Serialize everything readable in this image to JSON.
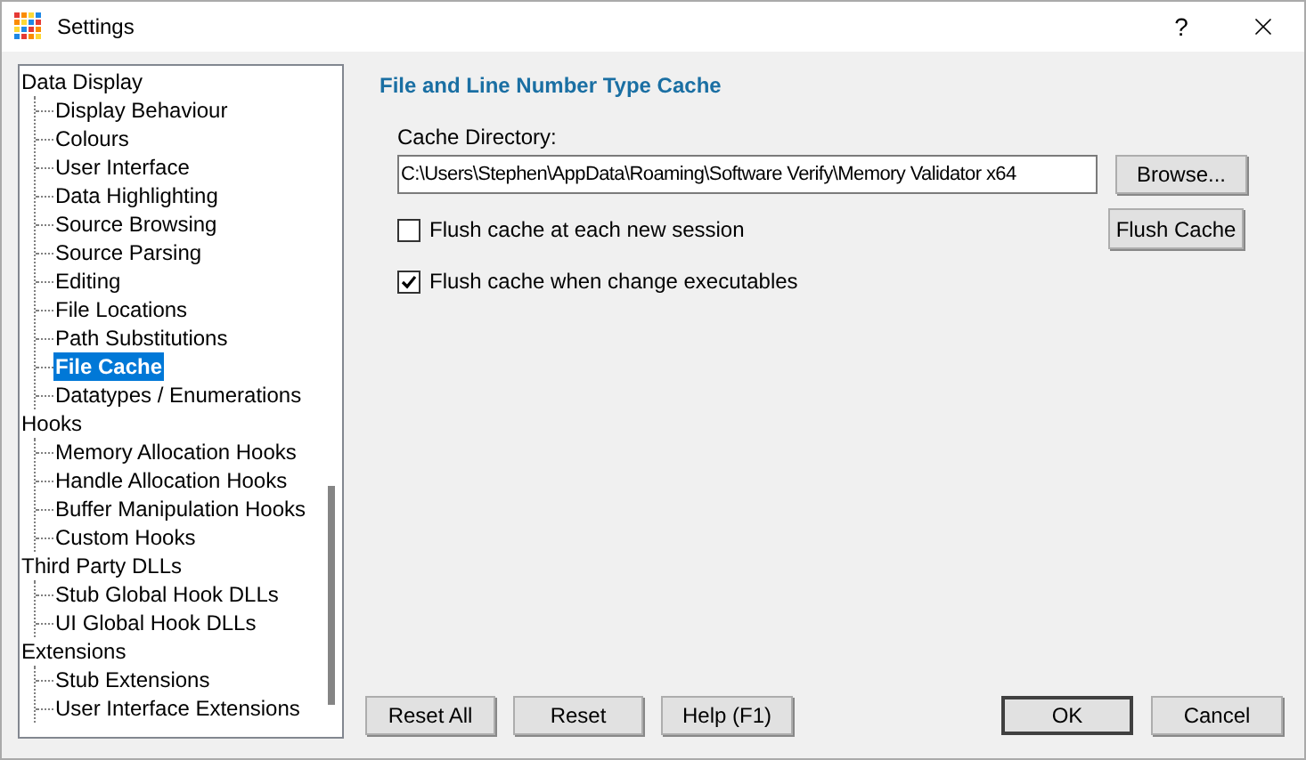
{
  "window": {
    "title": "Settings",
    "help": "?"
  },
  "tree": [
    {
      "label": "Data Display",
      "selected": false,
      "children": [
        {
          "label": "Display Behaviour",
          "selected": false
        },
        {
          "label": "Colours",
          "selected": false
        },
        {
          "label": "User Interface",
          "selected": false
        },
        {
          "label": "Data Highlighting",
          "selected": false
        },
        {
          "label": "Source Browsing",
          "selected": false
        },
        {
          "label": "Source Parsing",
          "selected": false
        },
        {
          "label": "Editing",
          "selected": false
        },
        {
          "label": "File Locations",
          "selected": false
        },
        {
          "label": "Path Substitutions",
          "selected": false
        },
        {
          "label": "File Cache",
          "selected": true
        },
        {
          "label": "Datatypes / Enumerations",
          "selected": false
        }
      ]
    },
    {
      "label": "Hooks",
      "selected": false,
      "children": [
        {
          "label": "Memory Allocation Hooks",
          "selected": false
        },
        {
          "label": "Handle Allocation Hooks",
          "selected": false
        },
        {
          "label": "Buffer Manipulation Hooks",
          "selected": false
        },
        {
          "label": "Custom Hooks",
          "selected": false
        }
      ]
    },
    {
      "label": "Third Party DLLs",
      "selected": false,
      "children": [
        {
          "label": "Stub Global Hook DLLs",
          "selected": false
        },
        {
          "label": "UI Global Hook DLLs",
          "selected": false
        }
      ]
    },
    {
      "label": "Extensions",
      "selected": false,
      "children": [
        {
          "label": "Stub Extensions",
          "selected": false
        },
        {
          "label": "User Interface Extensions",
          "selected": false
        }
      ]
    }
  ],
  "panel": {
    "heading": "File and Line Number Type Cache",
    "directory_label": "Cache Directory:",
    "directory": "C:\\Users\\Stephen\\AppData\\Roaming\\Software Verify\\Memory Validator x64",
    "browse_button": "Browse...",
    "flush_button": "Flush Cache",
    "checkboxes": [
      {
        "label": "Flush cache at each new session",
        "checked": false
      },
      {
        "label": "Flush cache when change executables",
        "checked": true
      }
    ]
  },
  "buttons": [
    {
      "label": "Reset All",
      "default": false
    },
    {
      "label": "Reset",
      "default": false
    },
    {
      "label": "Help (F1)",
      "default": false
    },
    {
      "label": "OK",
      "default": true
    },
    {
      "label": "Cancel",
      "default": false
    }
  ]
}
